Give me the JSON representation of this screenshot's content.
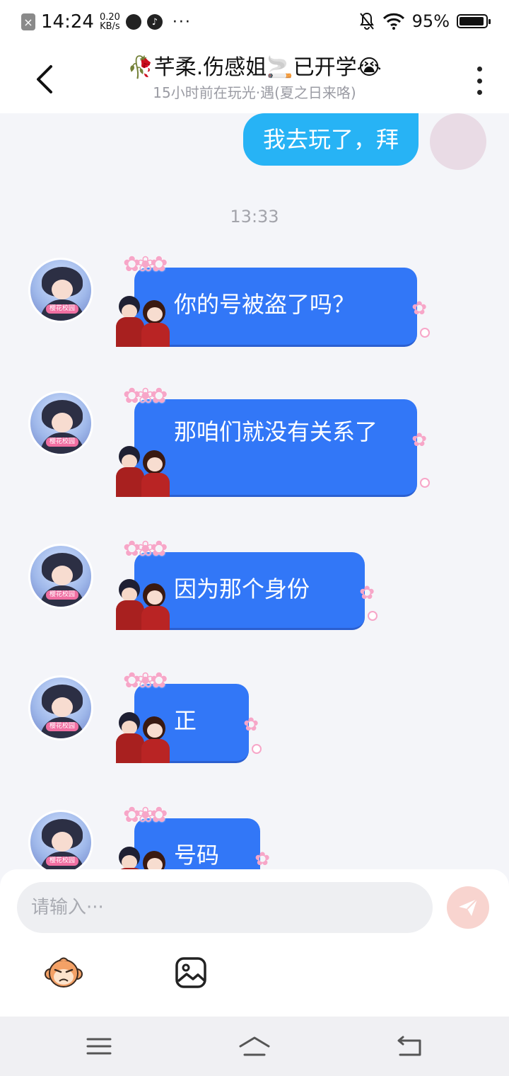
{
  "status_bar": {
    "time": "14:24",
    "net_speed_value": "0.20",
    "net_speed_unit": "KB/s",
    "more": "···",
    "battery": "95%",
    "battery_level": 0.95
  },
  "header": {
    "title": "🥀芊柔.伤感姐🚬已开学😭",
    "subtitle": "15小时前在玩光·遇(夏之日来咯)"
  },
  "chat": {
    "self_message": "我去玩了，拜",
    "timestamp": "13:33",
    "avatar_tag": "樱花校园",
    "messages": [
      {
        "text": "你的号被盗了吗？"
      },
      {
        "text": "那咱们就没有关系了"
      },
      {
        "text": "因为那个身份"
      },
      {
        "text": "正"
      },
      {
        "text": "号码"
      }
    ]
  },
  "composer": {
    "placeholder": "请输入···"
  },
  "icons": {
    "back": "back-arrow-icon",
    "more": "more-vertical-icon",
    "send": "send-icon",
    "emoji": "monkey-emoji-icon",
    "image": "image-icon",
    "nav_menu": "menu-icon",
    "nav_home": "home-icon",
    "nav_back": "return-icon"
  },
  "colors": {
    "self_bubble": "#27b3f5",
    "other_bubble": "#3277f7",
    "background": "#f4f5f9",
    "send_button": "#f8d4cf"
  }
}
